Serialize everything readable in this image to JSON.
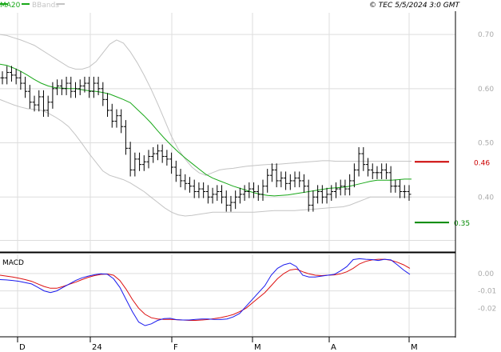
{
  "header": {
    "ma_label": "MA20",
    "bb_label": "BBands",
    "copyright": "© TEC 5/5/2024 3:0 GMT"
  },
  "colors": {
    "ma": "#19a819",
    "bbands": "#c4c4c4",
    "price": "#000000",
    "grid": "#dddddd",
    "macd": "#1a1aee",
    "signal": "#dd1111",
    "resistance": "#cc0000",
    "support": "#008800",
    "axis_text": "#aaaaaa"
  },
  "chart_data": [
    {
      "type": "line",
      "ohlc_bars": true,
      "x_tick_labels": [
        "D",
        "24",
        "F",
        "M",
        "A",
        "M"
      ],
      "y_tick_labels": [
        "0.70",
        "0.60",
        "0.50",
        "0.40"
      ],
      "ylim": [
        0.3,
        0.74
      ],
      "grid": true,
      "resistance": {
        "value": 0.465,
        "label": "0.46"
      },
      "support": {
        "value": 0.353,
        "label": "0.35"
      },
      "price_series": [
        0.62,
        0.63,
        0.625,
        0.62,
        0.61,
        0.595,
        0.575,
        0.57,
        0.585,
        0.56,
        0.575,
        0.6,
        0.605,
        0.6,
        0.61,
        0.595,
        0.6,
        0.605,
        0.61,
        0.595,
        0.61,
        0.6,
        0.58,
        0.56,
        0.54,
        0.55,
        0.53,
        0.49,
        0.45,
        0.47,
        0.46,
        0.465,
        0.475,
        0.48,
        0.485,
        0.475,
        0.47,
        0.455,
        0.44,
        0.43,
        0.425,
        0.42,
        0.41,
        0.415,
        0.41,
        0.4,
        0.405,
        0.41,
        0.4,
        0.385,
        0.39,
        0.4,
        0.405,
        0.41,
        0.415,
        0.41,
        0.405,
        0.42,
        0.44,
        0.45,
        0.43,
        0.435,
        0.425,
        0.43,
        0.435,
        0.43,
        0.42,
        0.385,
        0.4,
        0.41,
        0.4,
        0.405,
        0.41,
        0.415,
        0.42,
        0.415,
        0.43,
        0.45,
        0.48,
        0.46,
        0.45,
        0.445,
        0.445,
        0.45,
        0.445,
        0.42,
        0.42,
        0.41,
        0.41,
        0.405
      ],
      "ma20_series": [
        0.645,
        0.643,
        0.638,
        0.632,
        0.625,
        0.617,
        0.61,
        0.605,
        0.602,
        0.601,
        0.6,
        0.6,
        0.598,
        0.596,
        0.595,
        0.593,
        0.59,
        0.585,
        0.58,
        0.574,
        0.562,
        0.55,
        0.537,
        0.522,
        0.508,
        0.495,
        0.483,
        0.472,
        0.462,
        0.452,
        0.442,
        0.435,
        0.43,
        0.425,
        0.42,
        0.416,
        0.412,
        0.408,
        0.405,
        0.403,
        0.402,
        0.403,
        0.404,
        0.406,
        0.408,
        0.41,
        0.412,
        0.414,
        0.416,
        0.417,
        0.418,
        0.42,
        0.423,
        0.426,
        0.429,
        0.431,
        0.431,
        0.431,
        0.432,
        0.433,
        0.433
      ],
      "bb_upper_series": [
        0.7,
        0.698,
        0.694,
        0.69,
        0.685,
        0.68,
        0.672,
        0.664,
        0.656,
        0.648,
        0.64,
        0.636,
        0.636,
        0.64,
        0.65,
        0.666,
        0.682,
        0.69,
        0.684,
        0.668,
        0.648,
        0.625,
        0.6,
        0.572,
        0.542,
        0.512,
        0.488,
        0.47,
        0.455,
        0.445,
        0.44,
        0.445,
        0.45,
        0.452,
        0.453,
        0.455,
        0.457,
        0.458,
        0.459,
        0.46,
        0.46,
        0.461,
        0.462,
        0.463,
        0.464,
        0.465,
        0.466,
        0.467,
        0.467,
        0.466,
        0.466,
        0.466,
        0.466,
        0.466,
        0.466,
        0.466,
        0.466,
        0.466,
        0.466,
        0.466,
        0.466
      ],
      "bb_lower_series": [
        0.58,
        0.575,
        0.57,
        0.566,
        0.563,
        0.562,
        0.56,
        0.555,
        0.548,
        0.54,
        0.53,
        0.515,
        0.498,
        0.48,
        0.464,
        0.448,
        0.44,
        0.436,
        0.432,
        0.426,
        0.418,
        0.41,
        0.4,
        0.39,
        0.38,
        0.372,
        0.367,
        0.365,
        0.366,
        0.368,
        0.37,
        0.372,
        0.372,
        0.372,
        0.372,
        0.372,
        0.372,
        0.372,
        0.373,
        0.374,
        0.375,
        0.375,
        0.375,
        0.375,
        0.376,
        0.377,
        0.378,
        0.379,
        0.38,
        0.381,
        0.382,
        0.385,
        0.39,
        0.395,
        0.4,
        0.4,
        0.4,
        0.4,
        0.4,
        0.4,
        0.4
      ]
    },
    {
      "type": "line",
      "title": "MACD",
      "y_tick_labels": [
        "0.00",
        "-0.01",
        "-0.02"
      ],
      "ylim": [
        -0.036,
        0.011
      ],
      "grid": true,
      "series": [
        {
          "values": [
            -0.0035,
            -0.0037,
            -0.004,
            -0.0045,
            -0.0052,
            -0.006,
            -0.008,
            -0.01,
            -0.011,
            -0.01,
            -0.008,
            -0.006,
            -0.004,
            -0.0025,
            -0.0015,
            -0.0007,
            -0.0002,
            -0.0004,
            -0.003,
            -0.008,
            -0.015,
            -0.022,
            -0.028,
            -0.03,
            -0.029,
            -0.027,
            -0.026,
            -0.0258,
            -0.0266,
            -0.0268,
            -0.0268,
            -0.0264,
            -0.0262,
            -0.0262,
            -0.0264,
            -0.0265,
            -0.0262,
            -0.025,
            -0.023,
            -0.019,
            -0.015,
            -0.011,
            -0.007,
            -0.001,
            0.003,
            0.005,
            0.006,
            0.004,
            -0.001,
            -0.002,
            -0.002,
            -0.0015,
            -0.001,
            -0.0005,
            0.0015,
            0.004,
            0.008,
            0.0085,
            0.0082,
            0.008,
            0.0075,
            0.0082,
            0.0078,
            0.005,
            0.002,
            -0.0005
          ]
        },
        {
          "values": [
            -0.001,
            -0.0015,
            -0.002,
            -0.0027,
            -0.0035,
            -0.0045,
            -0.006,
            -0.0075,
            -0.0085,
            -0.0085,
            -0.0075,
            -0.0062,
            -0.005,
            -0.0035,
            -0.0022,
            -0.0012,
            -0.0005,
            -0.0003,
            -0.001,
            -0.004,
            -0.009,
            -0.015,
            -0.02,
            -0.0235,
            -0.0255,
            -0.0262,
            -0.0264,
            -0.0264,
            -0.0266,
            -0.0268,
            -0.027,
            -0.027,
            -0.0268,
            -0.0265,
            -0.026,
            -0.0254,
            -0.0246,
            -0.0236,
            -0.022,
            -0.02,
            -0.017,
            -0.014,
            -0.011,
            -0.007,
            -0.003,
            0.0,
            0.002,
            0.0025,
            0.001,
            -0.0002,
            -0.001,
            -0.0012,
            -0.001,
            -0.0008,
            -0.0002,
            0.001,
            0.003,
            0.0055,
            0.007,
            0.0078,
            0.0082,
            0.0082,
            0.0076,
            0.0065,
            0.005,
            0.003
          ]
        }
      ]
    }
  ]
}
